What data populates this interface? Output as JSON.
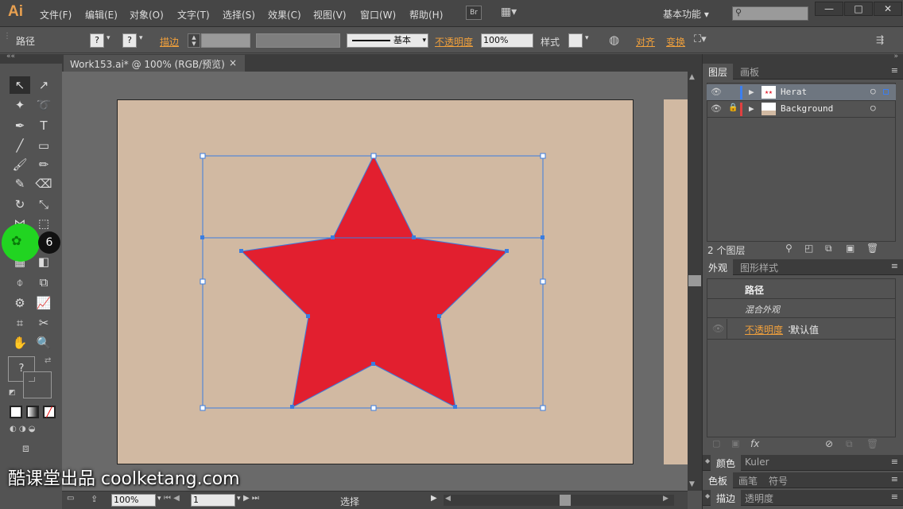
{
  "app": {
    "logo": "Ai"
  },
  "menu": [
    "文件(F)",
    "编辑(E)",
    "对象(O)",
    "文字(T)",
    "选择(S)",
    "效果(C)",
    "视图(V)",
    "窗口(W)",
    "帮助(H)"
  ],
  "topbar": {
    "bridge": "Br",
    "workspace": "基本功能"
  },
  "control": {
    "object_type": "路径",
    "fill_box": "?",
    "stroke_box": "?",
    "stroke_label": "描边",
    "brush_label": "基本",
    "opacity_label": "不透明度",
    "opacity_value": "100%",
    "style_label": "样式",
    "align_label": "对齐",
    "transform_label": "变换"
  },
  "document": {
    "tab_title": "Work153.ai* @ 100% (RGB/预览)",
    "close": "×"
  },
  "toolbox": {
    "fill_stroke_glyph": "?"
  },
  "overlay": {
    "step_number": "6",
    "watermark": "酷课堂出品 coolketang.com"
  },
  "status": {
    "zoom": "100%",
    "page": "1",
    "tool": "选择"
  },
  "layers_panel": {
    "tabs": [
      "图层",
      "画板"
    ],
    "layers": [
      {
        "name": "Herat",
        "color": "#3c7ff0"
      },
      {
        "name": "Background",
        "color": "#e04040"
      }
    ],
    "count": "2 个图层"
  },
  "appearance_panel": {
    "tabs": [
      "外观",
      "图形样式"
    ],
    "title": "路径",
    "subtitle": "混合外观",
    "opacity_label": "不透明度",
    "opacity_value": "默认值",
    "fx": "fx"
  },
  "color_panel": {
    "tabs": [
      "颜色",
      "Kuler"
    ]
  },
  "swatches_panel": {
    "tabs": [
      "色板",
      "画笔",
      "符号"
    ]
  },
  "stroke_panel": {
    "tabs": [
      "描边",
      "透明度"
    ]
  },
  "colors": {
    "star": "#e21f2f",
    "artboard": "#d1b9a2",
    "selection": "#3a7de0"
  }
}
